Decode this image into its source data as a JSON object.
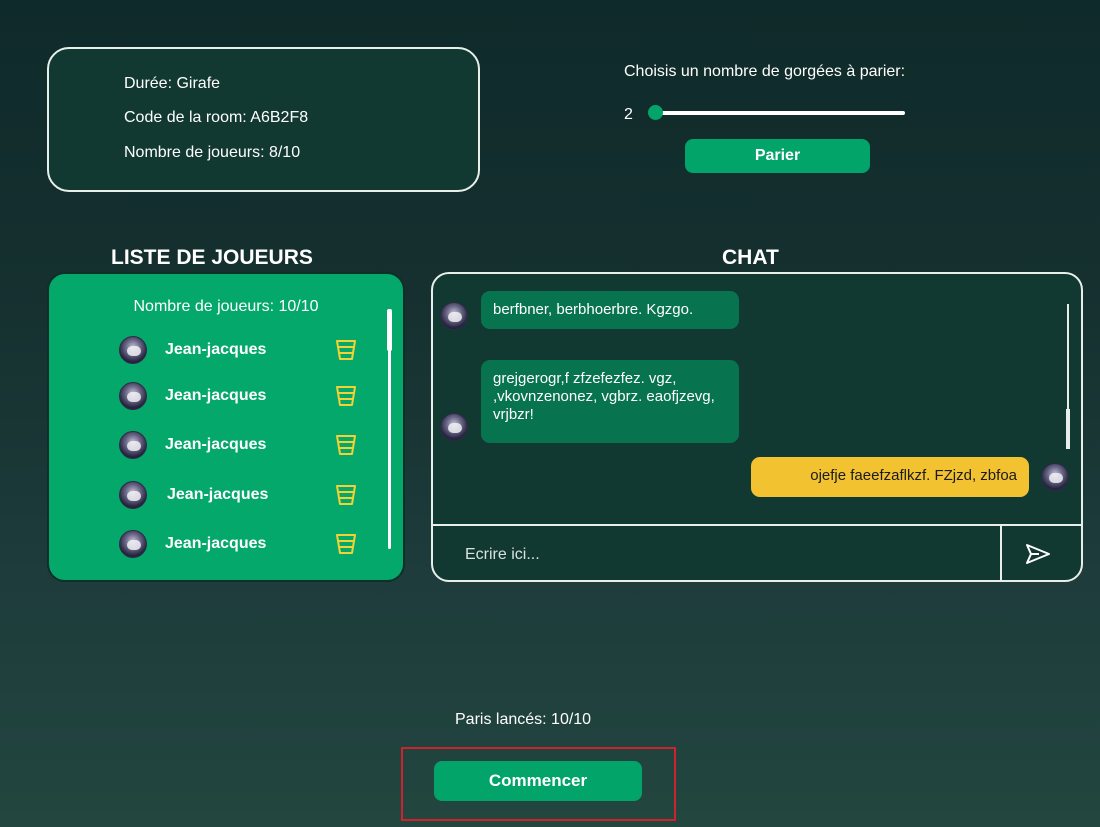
{
  "room_info": {
    "duration": "Durée: Girafe",
    "room_code": "Code de la room: A6B2F8",
    "players": "Nombre de joueurs: 8/10"
  },
  "bet": {
    "label": "Choisis un nombre de gorgées à parier:",
    "value": "2",
    "slider_fraction": 0,
    "button": "Parier"
  },
  "players_panel": {
    "title": "LISTE DE JOUEURS",
    "count": "Nombre de joueurs: 10/10",
    "players": [
      {
        "name": "Jean-jacques",
        "icon": "cup-icon"
      },
      {
        "name": "Jean-jacques",
        "icon": "cup-icon"
      },
      {
        "name": "Jean-jacques",
        "icon": "cup-icon"
      },
      {
        "name": "Jean-jacques",
        "icon": "cup-icon"
      },
      {
        "name": "Jean-jacques",
        "icon": "cup-icon"
      }
    ]
  },
  "chat": {
    "title": "CHAT",
    "messages": [
      {
        "side": "in",
        "text": "berfbner, berbhoerbre. Kgzgo."
      },
      {
        "side": "in",
        "text": "grejgerogr,f zfzefezfez. vgz, ,vkovnzenonez, vgbrz. eaofjzevg, vrjbzr!"
      },
      {
        "side": "out",
        "text": "ojefje faeefzaflkzf. FZjzd, zbfoa"
      }
    ],
    "input_placeholder": "Ecrire ici...",
    "send_icon": "send-icon"
  },
  "footer": {
    "paris_count": "Paris lancés: 10/10",
    "start_button": "Commencer"
  },
  "colors": {
    "accent_green": "#03a46a",
    "player_card_green": "#05a86b",
    "incoming_bubble": "#08734f",
    "outgoing_bubble": "#f2c230",
    "cup_yellow": "#f5d234",
    "highlight_red": "#d0212e"
  }
}
